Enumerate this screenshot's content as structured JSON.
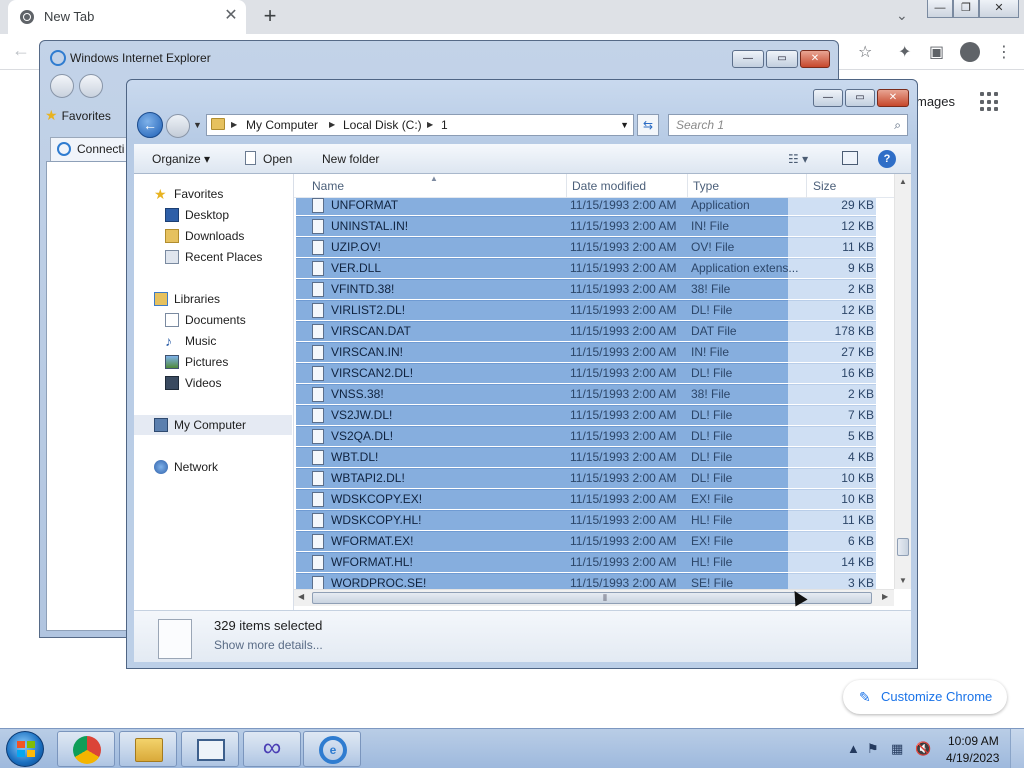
{
  "chrome": {
    "tab_title": "New Tab",
    "tab_close": "✕",
    "new_tab": "+",
    "images_link": "mages",
    "customize_label": "Customize Chrome"
  },
  "ie": {
    "title": "Windows Internet Explorer",
    "favorites": "Favorites",
    "tab_label": "Connecti"
  },
  "explorer": {
    "breadcrumbs": [
      "My Computer",
      "Local Disk (C:)",
      "1"
    ],
    "search_placeholder": "Search 1",
    "toolbar": {
      "organize": "Organize ▾",
      "open": "Open",
      "new_folder": "New folder"
    },
    "nav": {
      "favorites": "Favorites",
      "desktop": "Desktop",
      "downloads": "Downloads",
      "recent_places": "Recent Places",
      "libraries": "Libraries",
      "documents": "Documents",
      "music": "Music",
      "pictures": "Pictures",
      "videos": "Videos",
      "my_computer": "My Computer",
      "network": "Network"
    },
    "columns": {
      "name": "Name",
      "date_modified": "Date modified",
      "type": "Type",
      "size": "Size"
    },
    "files": [
      {
        "name": "UNFORMAT",
        "date": "11/15/1993 2:00 AM",
        "type": "Application",
        "size": "29 KB"
      },
      {
        "name": "UNINSTAL.IN!",
        "date": "11/15/1993 2:00 AM",
        "type": "IN! File",
        "size": "12 KB"
      },
      {
        "name": "UZIP.OV!",
        "date": "11/15/1993 2:00 AM",
        "type": "OV! File",
        "size": "11 KB"
      },
      {
        "name": "VER.DLL",
        "date": "11/15/1993 2:00 AM",
        "type": "Application extens...",
        "size": "9 KB"
      },
      {
        "name": "VFINTD.38!",
        "date": "11/15/1993 2:00 AM",
        "type": "38! File",
        "size": "2 KB"
      },
      {
        "name": "VIRLIST2.DL!",
        "date": "11/15/1993 2:00 AM",
        "type": "DL! File",
        "size": "12 KB"
      },
      {
        "name": "VIRSCAN.DAT",
        "date": "11/15/1993 2:00 AM",
        "type": "DAT File",
        "size": "178 KB"
      },
      {
        "name": "VIRSCAN.IN!",
        "date": "11/15/1993 2:00 AM",
        "type": "IN! File",
        "size": "27 KB"
      },
      {
        "name": "VIRSCAN2.DL!",
        "date": "11/15/1993 2:00 AM",
        "type": "DL! File",
        "size": "16 KB"
      },
      {
        "name": "VNSS.38!",
        "date": "11/15/1993 2:00 AM",
        "type": "38! File",
        "size": "2 KB"
      },
      {
        "name": "VS2JW.DL!",
        "date": "11/15/1993 2:00 AM",
        "type": "DL! File",
        "size": "7 KB"
      },
      {
        "name": "VS2QA.DL!",
        "date": "11/15/1993 2:00 AM",
        "type": "DL! File",
        "size": "5 KB"
      },
      {
        "name": "WBT.DL!",
        "date": "11/15/1993 2:00 AM",
        "type": "DL! File",
        "size": "4 KB"
      },
      {
        "name": "WBTAPI2.DL!",
        "date": "11/15/1993 2:00 AM",
        "type": "DL! File",
        "size": "10 KB"
      },
      {
        "name": "WDSKCOPY.EX!",
        "date": "11/15/1993 2:00 AM",
        "type": "EX! File",
        "size": "10 KB"
      },
      {
        "name": "WDSKCOPY.HL!",
        "date": "11/15/1993 2:00 AM",
        "type": "HL! File",
        "size": "11 KB"
      },
      {
        "name": "WFORMAT.EX!",
        "date": "11/15/1993 2:00 AM",
        "type": "EX! File",
        "size": "6 KB"
      },
      {
        "name": "WFORMAT.HL!",
        "date": "11/15/1993 2:00 AM",
        "type": "HL! File",
        "size": "14 KB"
      },
      {
        "name": "WORDPROC.SE!",
        "date": "11/15/1993 2:00 AM",
        "type": "SE! File",
        "size": "3 KB"
      }
    ],
    "details": {
      "count": "329 items selected",
      "more": "Show more details..."
    }
  },
  "taskbar": {
    "time": "10:09 AM",
    "date": "4/19/2023"
  },
  "colors": {
    "selection": "#86aede",
    "selection_light": "#cfdff3",
    "window_frame": "#bccfe7",
    "chrome_accent": "#1a73e8"
  },
  "icons": {
    "chrome_customize": "pencil-icon",
    "explorer_search": "magnifier-icon"
  }
}
